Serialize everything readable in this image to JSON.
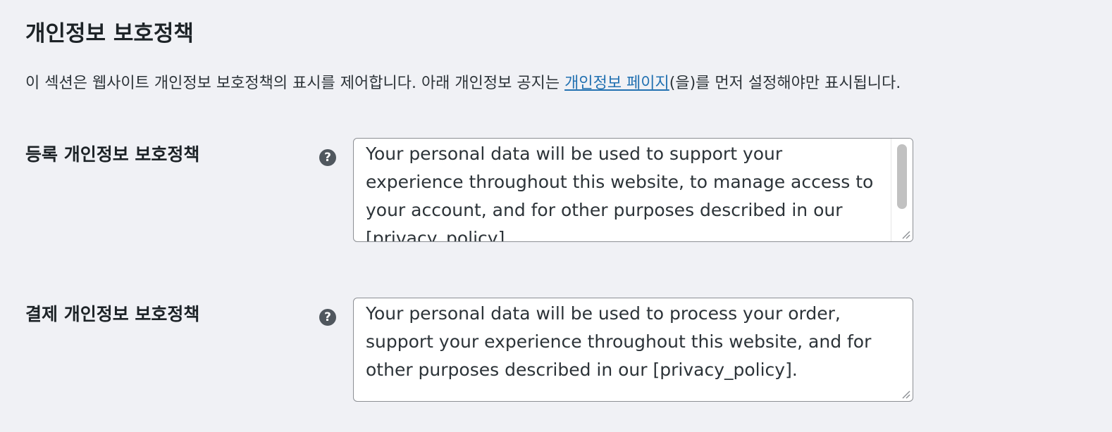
{
  "section": {
    "title": "개인정보 보호정책",
    "desc_before": "이 섹션은 웹사이트 개인정보 보호정책의 표시를 제어합니다. 아래 개인정보 공지는 ",
    "desc_link": "개인정보 페이지",
    "desc_after": "(을)를 먼저 설정해야만 표시됩니다."
  },
  "fields": [
    {
      "label": "등록 개인정보 보호정책",
      "help_icon": "?",
      "value": "Your personal data will be used to support your experience throughout this website, to manage access to your account, and for other purposes described in our [privacy_policy]."
    },
    {
      "label": "결제 개인정보 보호정책",
      "help_icon": "?",
      "value": "Your personal data will be used to process your order, support your experience throughout this website, and for other purposes described in our [privacy_policy]."
    }
  ],
  "colors": {
    "background": "#f0f1f5",
    "link": "#2271b1",
    "help_icon_bg": "#50575e",
    "textarea_border": "#8c8f94"
  }
}
